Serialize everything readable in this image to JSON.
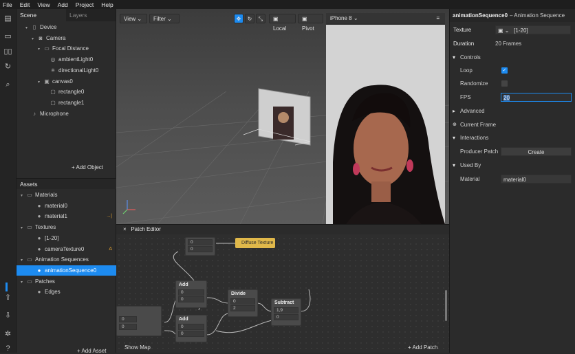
{
  "menu": [
    "File",
    "Edit",
    "View",
    "Add",
    "Project",
    "Help"
  ],
  "scene_tabs": {
    "scene": "Scene",
    "layers": "Layers"
  },
  "tree": [
    {
      "label": "Device",
      "indent": 1,
      "icon": "device-icon"
    },
    {
      "label": "Camera",
      "indent": 2,
      "icon": "camera-icon"
    },
    {
      "label": "Focal Distance",
      "indent": 3,
      "icon": "focal-icon"
    },
    {
      "label": "ambientLight0",
      "indent": 4,
      "icon": "light-icon"
    },
    {
      "label": "directionalLight0",
      "indent": 4,
      "icon": "sun-icon"
    },
    {
      "label": "canvas0",
      "indent": 3,
      "icon": "canvas-icon"
    },
    {
      "label": "rectangle0",
      "indent": 4,
      "icon": "rectangle-icon"
    },
    {
      "label": "rectangle1",
      "indent": 4,
      "icon": "rectangle-icon"
    },
    {
      "label": "Microphone",
      "indent": 1,
      "icon": "microphone-icon"
    }
  ],
  "add_object": "+ Add Object",
  "assets_title": "Assets",
  "assets": [
    {
      "label": "Materials",
      "indent": 0,
      "folder": true
    },
    {
      "label": "material0",
      "indent": 1
    },
    {
      "label": "material1",
      "indent": 1,
      "badge": "→|"
    },
    {
      "label": "Textures",
      "indent": 0,
      "folder": true
    },
    {
      "label": "[1-20]",
      "indent": 1
    },
    {
      "label": "cameraTexture0",
      "indent": 1,
      "badge": "A"
    },
    {
      "label": "Animation Sequences",
      "indent": 0,
      "folder": true
    },
    {
      "label": "animationSequence0",
      "indent": 1,
      "selected": true
    },
    {
      "label": "Patches",
      "indent": 0,
      "folder": true
    },
    {
      "label": "Edges",
      "indent": 1
    }
  ],
  "add_asset": "+ Add Asset",
  "viewport": {
    "view": "View",
    "filter": "Filter",
    "local": "Local",
    "pivot": "Pivot"
  },
  "device": {
    "name": "iPhone 8"
  },
  "patch_editor": {
    "title": "Patch Editor",
    "show_map": "Show Map",
    "add_patch": "+ Add Patch",
    "diffuse": "Diffuse Texture",
    "nodes": {
      "add1": "Add",
      "add2": "Add",
      "divide": "Divide",
      "subtract": "Subtract",
      "v0": "0",
      "v2": "2",
      "v19": "1,9"
    }
  },
  "props": {
    "title": "animationSequence0",
    "subtitle": "– Animation Sequence",
    "texture_label": "Texture",
    "texture_value": "[1-20]",
    "duration_label": "Duration",
    "duration_value": "20 Frames",
    "controls": "Controls",
    "loop": "Loop",
    "loop_checked": true,
    "randomize": "Randomize",
    "randomize_checked": false,
    "fps": "FPS",
    "fps_value": "20",
    "advanced": "Advanced",
    "current_frame": "Current Frame",
    "interactions": "Interactions",
    "producer_patch": "Producer Patch",
    "create": "Create",
    "used_by": "Used By",
    "material": "Material",
    "material_value": "material0"
  },
  "colors": {
    "accent": "#1d8bf0",
    "texture_node": "#e0b84a"
  }
}
